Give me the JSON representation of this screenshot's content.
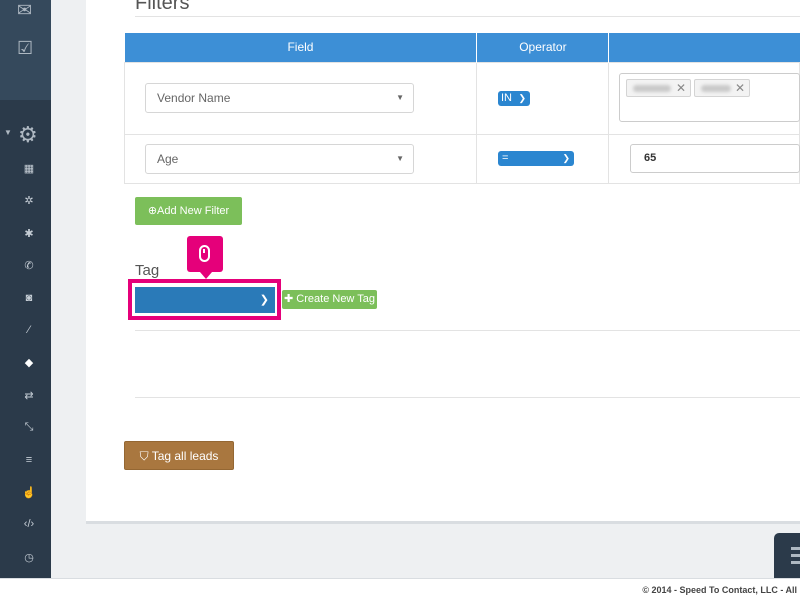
{
  "filters": {
    "title": "Filters",
    "columns": [
      "Field",
      "Operator",
      ""
    ],
    "rows": [
      {
        "field": "Vendor Name",
        "operator": "IN",
        "value_type": "multi"
      },
      {
        "field": "Age",
        "operator": "=",
        "value": "65"
      }
    ],
    "add_button": "Add New Filter"
  },
  "tag": {
    "label": "Tag",
    "selected": "",
    "create_button": "Create New Tag"
  },
  "tag_all_button": "Tag all leads",
  "footer": "© 2014 - Speed To Contact, LLC - All",
  "colors": {
    "sidebar": "#2b3a4a",
    "header_blue": "#3d8fd6",
    "green": "#7cbf5a",
    "brown": "#a9773f",
    "highlight": "#e5007a"
  },
  "icons": {
    "sidebar": [
      "envelope-icon",
      "check-square-icon",
      "gear-icon",
      "building-icon",
      "cog-icon",
      "cogs-icon",
      "phone-icon",
      "phone-square-icon",
      "magic-icon",
      "tag-icon",
      "exchange-icon",
      "compress-icon",
      "sliders-icon",
      "thumbs-up-icon",
      "code-icon",
      "clock-icon"
    ]
  }
}
